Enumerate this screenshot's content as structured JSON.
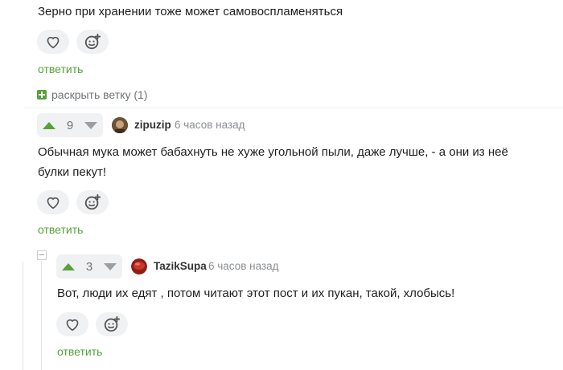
{
  "comments": [
    {
      "text_lines": [
        "Зерно при хранении тоже может самовоспламеняться"
      ],
      "reply_label": "ответить"
    },
    {
      "rating": "9",
      "author": "zipuzip",
      "time": "6 часов назад",
      "text_lines": [
        "Обычная мука может бабахнуть не хуже угольной пыли, даже лучше, - а они из неё",
        "булки пекут!"
      ],
      "reply_label": "ответить"
    },
    {
      "rating": "3",
      "author": "TazikSupa",
      "time": "6 часов назад",
      "text_lines": [
        "Вот, люди их едят , потом читают этот пост и их пукан, такой, хлобысь!"
      ],
      "reply_label": "ответить"
    }
  ],
  "expand_branch": {
    "label": "раскрыть ветку (1)"
  },
  "colors": {
    "accent_green": "#56a13a",
    "arrow_up": "#56a13a",
    "arrow_down": "#9a9ea3"
  },
  "icons": [
    "heart-icon",
    "emoji-add-icon",
    "upvote-icon",
    "downvote-icon",
    "expand-plus-icon",
    "collapse-minus-icon"
  ]
}
